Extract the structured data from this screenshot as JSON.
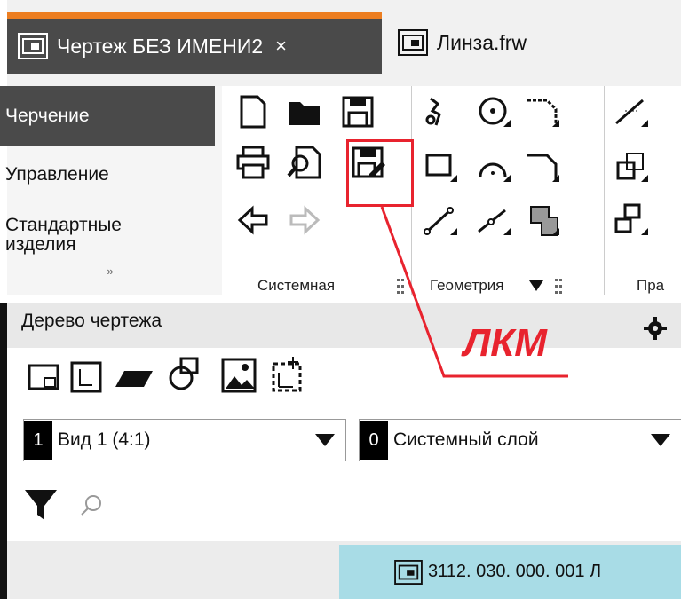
{
  "tabs": [
    {
      "label": "Чертеж БЕЗ ИМЕНИ2",
      "close": "×",
      "icon": "drawing-doc-icon"
    },
    {
      "label": "Линза.frw",
      "icon": "drawing-doc-icon"
    }
  ],
  "nav": {
    "items": [
      "Черчение",
      "Управление",
      "Стандартные\nизделия"
    ],
    "more": "»"
  },
  "ribbon": {
    "groups": [
      {
        "label": "Системная"
      },
      {
        "label": "Геометрия",
        "has_dropdown": true
      },
      {
        "label": "Пра"
      }
    ]
  },
  "annotation": {
    "text": "ЛКМ",
    "color": "#e8232e"
  },
  "tree": {
    "title": "Дерево чертежа",
    "view_select": {
      "number": "1",
      "label": "Вид 1 (4:1)"
    },
    "layer_select": {
      "number": "0",
      "label": "Системный слой"
    },
    "search_placeholder": "",
    "item_label": "3112. 030. 000. 001 Л"
  },
  "colors": {
    "accent": "#ec7e21",
    "dark": "#4a4a4a",
    "highlight": "#e8232e",
    "selected_row": "#a8dce6"
  }
}
